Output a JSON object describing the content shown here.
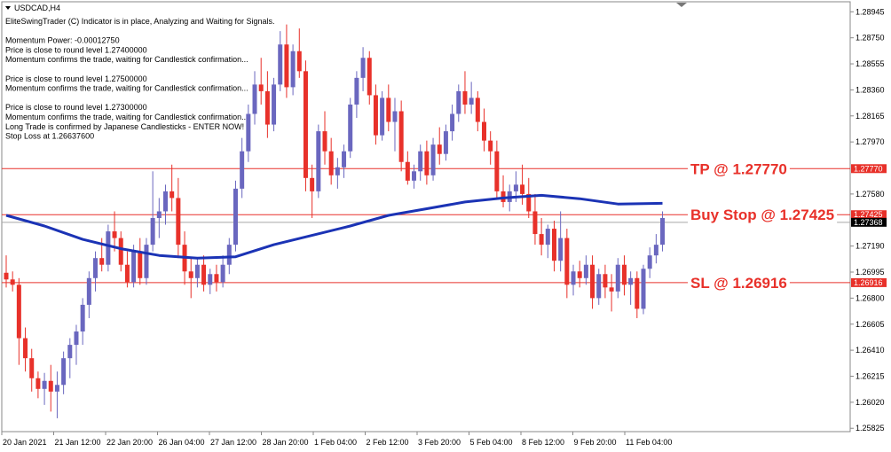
{
  "symbol": {
    "title": "USDCAD,H4",
    "arrow_icon": "triangle-down-icon"
  },
  "info_lines": [
    "EliteSwingTrader (C) Indicator is in place, Analyzing and Waiting for Signals.",
    "",
    "Momentum Power: -0.00012750",
    "Price is close to round level 1.27400000",
    "Momentum confirms the trade, waiting for Candlestick confirmation...",
    "",
    "Price is close to round level 1.27500000",
    "Momentum confirms the trade, waiting for Candlestick confirmation...",
    "",
    "Price is close to round level 1.27300000",
    "Momentum confirms the trade, waiting for Candlestick confirmation...",
    "Long Trade is confirmed by Japanese Candlesticks - ENTER NOW!",
    "Stop Loss at 1.26637600"
  ],
  "colors": {
    "bull": "#6a67bf",
    "bear": "#e8312a",
    "ma": "#1b33b5",
    "level": "#e8312a",
    "current": "#000000"
  },
  "chart_data": {
    "type": "candlestick",
    "ylim": [
      1.258,
      1.2902
    ],
    "y_ticks": [
      "1.28945",
      "1.28750",
      "1.28555",
      "1.28360",
      "1.28165",
      "1.27970",
      "1.27580",
      "1.27190",
      "1.26995",
      "1.26800",
      "1.26605",
      "1.26410",
      "1.26215",
      "1.26020",
      "1.25825"
    ],
    "x_ticks": [
      "20 Jan 2021",
      "21 Jan 12:00",
      "22 Jan 20:00",
      "26 Jan 04:00",
      "27 Jan 12:00",
      "28 Jan 20:00",
      "1 Feb 04:00",
      "2 Feb 12:00",
      "3 Feb 20:00",
      "5 Feb 04:00",
      "8 Feb 12:00",
      "9 Feb 20:00",
      "11 Feb 04:00"
    ],
    "levels": [
      {
        "name": "TP",
        "value": 1.2777,
        "label": "TP @ 1.27770",
        "tag": "1.27770"
      },
      {
        "name": "Buy Stop",
        "value": 1.27425,
        "label": "Buy Stop @ 1.27425",
        "tag": "1.27425"
      },
      {
        "name": "SL",
        "value": 1.26916,
        "label": "SL @ 1.26916",
        "tag": "1.26916"
      }
    ],
    "current_price": {
      "value": 1.27368,
      "tag": "1.27368"
    },
    "candles": [
      [
        1.2699,
        1.2712,
        1.2688,
        1.2694
      ],
      [
        1.2694,
        1.27,
        1.2685,
        1.269
      ],
      [
        1.269,
        1.2695,
        1.263,
        1.265
      ],
      [
        1.265,
        1.2658,
        1.2625,
        1.2635
      ],
      [
        1.2635,
        1.2642,
        1.261,
        1.262
      ],
      [
        1.262,
        1.2625,
        1.2605,
        1.2612
      ],
      [
        1.2612,
        1.2624,
        1.26,
        1.2618
      ],
      [
        1.2618,
        1.263,
        1.2595,
        1.261
      ],
      [
        1.261,
        1.2625,
        1.259,
        1.2615
      ],
      [
        1.2615,
        1.264,
        1.2608,
        1.2635
      ],
      [
        1.2635,
        1.265,
        1.262,
        1.2645
      ],
      [
        1.2645,
        1.266,
        1.263,
        1.2655
      ],
      [
        1.2655,
        1.268,
        1.2645,
        1.2675
      ],
      [
        1.2675,
        1.27,
        1.2665,
        1.2695
      ],
      [
        1.2695,
        1.2715,
        1.2685,
        1.271
      ],
      [
        1.271,
        1.2725,
        1.27,
        1.2705
      ],
      [
        1.2705,
        1.2735,
        1.27,
        1.273
      ],
      [
        1.273,
        1.2745,
        1.2715,
        1.2725
      ],
      [
        1.2725,
        1.273,
        1.27,
        1.2705
      ],
      [
        1.2705,
        1.2715,
        1.2688,
        1.2692
      ],
      [
        1.2692,
        1.272,
        1.2688,
        1.2715
      ],
      [
        1.2715,
        1.2725,
        1.269,
        1.2695
      ],
      [
        1.2695,
        1.2725,
        1.269,
        1.272
      ],
      [
        1.272,
        1.2775,
        1.2715,
        1.274
      ],
      [
        1.274,
        1.2755,
        1.2725,
        1.2745
      ],
      [
        1.2745,
        1.2765,
        1.2735,
        1.276
      ],
      [
        1.276,
        1.278,
        1.2745,
        1.2755
      ],
      [
        1.2755,
        1.277,
        1.271,
        1.272
      ],
      [
        1.272,
        1.273,
        1.269,
        1.27
      ],
      [
        1.27,
        1.271,
        1.268,
        1.2695
      ],
      [
        1.2695,
        1.271,
        1.2688,
        1.2705
      ],
      [
        1.2705,
        1.2712,
        1.2685,
        1.269
      ],
      [
        1.269,
        1.2702,
        1.2683,
        1.2698
      ],
      [
        1.2698,
        1.2705,
        1.2685,
        1.2692
      ],
      [
        1.2692,
        1.2712,
        1.2688,
        1.2705
      ],
      [
        1.2705,
        1.2725,
        1.2698,
        1.272
      ],
      [
        1.272,
        1.2768,
        1.2715,
        1.2762
      ],
      [
        1.2762,
        1.28,
        1.2755,
        1.279
      ],
      [
        1.279,
        1.2825,
        1.2782,
        1.2818
      ],
      [
        1.2818,
        1.285,
        1.281,
        1.284
      ],
      [
        1.284,
        1.286,
        1.2825,
        1.2835
      ],
      [
        1.2835,
        1.285,
        1.28,
        1.281
      ],
      [
        1.281,
        1.2845,
        1.2805,
        1.284
      ],
      [
        1.284,
        1.288,
        1.2835,
        1.287
      ],
      [
        1.287,
        1.2885,
        1.283,
        1.2838
      ],
      [
        1.2838,
        1.287,
        1.2832,
        1.2865
      ],
      [
        1.2865,
        1.2882,
        1.2845,
        1.285
      ],
      [
        1.285,
        1.2858,
        1.276,
        1.277
      ],
      [
        1.277,
        1.278,
        1.274,
        1.276
      ],
      [
        1.276,
        1.281,
        1.2755,
        1.2805
      ],
      [
        1.2805,
        1.282,
        1.278,
        1.279
      ],
      [
        1.279,
        1.28,
        1.2765,
        1.2772
      ],
      [
        1.2772,
        1.2785,
        1.2762,
        1.2778
      ],
      [
        1.2778,
        1.2795,
        1.277,
        1.279
      ],
      [
        1.279,
        1.283,
        1.2785,
        1.2825
      ],
      [
        1.2825,
        1.285,
        1.2815,
        1.2845
      ],
      [
        1.2845,
        1.2868,
        1.2835,
        1.286
      ],
      [
        1.286,
        1.2865,
        1.2825,
        1.2832
      ],
      [
        1.2832,
        1.284,
        1.2795,
        1.2802
      ],
      [
        1.2802,
        1.2835,
        1.2798,
        1.283
      ],
      [
        1.283,
        1.284,
        1.2805,
        1.2812
      ],
      [
        1.2812,
        1.283,
        1.279,
        1.282
      ],
      [
        1.282,
        1.2828,
        1.2775,
        1.2782
      ],
      [
        1.2782,
        1.279,
        1.2765,
        1.2768
      ],
      [
        1.2768,
        1.278,
        1.2762,
        1.2775
      ],
      [
        1.2775,
        1.2795,
        1.2768,
        1.279
      ],
      [
        1.279,
        1.2798,
        1.2765,
        1.2772
      ],
      [
        1.2772,
        1.28,
        1.2768,
        1.2795
      ],
      [
        1.2795,
        1.2808,
        1.278,
        1.2788
      ],
      [
        1.2788,
        1.281,
        1.2783,
        1.2805
      ],
      [
        1.2805,
        1.2825,
        1.2798,
        1.2818
      ],
      [
        1.2818,
        1.284,
        1.2812,
        1.2835
      ],
      [
        1.2835,
        1.285,
        1.2818,
        1.2825
      ],
      [
        1.2825,
        1.2842,
        1.2818,
        1.283
      ],
      [
        1.283,
        1.2835,
        1.2805,
        1.2812
      ],
      [
        1.2812,
        1.2822,
        1.279,
        1.2798
      ],
      [
        1.2798,
        1.2805,
        1.278,
        1.279
      ],
      [
        1.279,
        1.2798,
        1.2755,
        1.276
      ],
      [
        1.276,
        1.2772,
        1.2748,
        1.2752
      ],
      [
        1.2752,
        1.2765,
        1.2745,
        1.276
      ],
      [
        1.276,
        1.2775,
        1.2752,
        1.2765
      ],
      [
        1.2765,
        1.278,
        1.275,
        1.2758
      ],
      [
        1.2758,
        1.277,
        1.274,
        1.2745
      ],
      [
        1.2745,
        1.2758,
        1.272,
        1.2728
      ],
      [
        1.2728,
        1.274,
        1.2712,
        1.272
      ],
      [
        1.272,
        1.2735,
        1.271,
        1.2732
      ],
      [
        1.2732,
        1.2738,
        1.27,
        1.2708
      ],
      [
        1.2708,
        1.2745,
        1.27,
        1.2725
      ],
      [
        1.2725,
        1.2732,
        1.268,
        1.269
      ],
      [
        1.269,
        1.2705,
        1.2682,
        1.27
      ],
      [
        1.27,
        1.2708,
        1.2688,
        1.2695
      ],
      [
        1.2695,
        1.2712,
        1.269,
        1.2705
      ],
      [
        1.2705,
        1.2712,
        1.2672,
        1.268
      ],
      [
        1.268,
        1.2702,
        1.2675,
        1.2698
      ],
      [
        1.2698,
        1.2705,
        1.268,
        1.2688
      ],
      [
        1.2688,
        1.2698,
        1.267,
        1.2685
      ],
      [
        1.2685,
        1.271,
        1.268,
        1.2705
      ],
      [
        1.2705,
        1.2712,
        1.2682,
        1.269
      ],
      [
        1.269,
        1.27,
        1.2675,
        1.2695
      ],
      [
        1.2695,
        1.27,
        1.2665,
        1.2672
      ],
      [
        1.2672,
        1.2705,
        1.2668,
        1.2702
      ],
      [
        1.2702,
        1.2718,
        1.2695,
        1.2712
      ],
      [
        1.2712,
        1.2728,
        1.2706,
        1.272
      ],
      [
        1.272,
        1.2745,
        1.2715,
        1.274
      ]
    ],
    "ma": [
      [
        0,
        1.2742
      ],
      [
        6,
        1.2734
      ],
      [
        12,
        1.2724
      ],
      [
        18,
        1.2717
      ],
      [
        24,
        1.2712
      ],
      [
        30,
        1.271
      ],
      [
        36,
        1.2711
      ],
      [
        42,
        1.272
      ],
      [
        48,
        1.2727
      ],
      [
        54,
        1.2734
      ],
      [
        60,
        1.2742
      ],
      [
        66,
        1.2747
      ],
      [
        72,
        1.2752
      ],
      [
        78,
        1.2755
      ],
      [
        84,
        1.2757
      ],
      [
        90,
        1.27545
      ],
      [
        96,
        1.27505
      ],
      [
        103,
        1.2751
      ]
    ]
  }
}
